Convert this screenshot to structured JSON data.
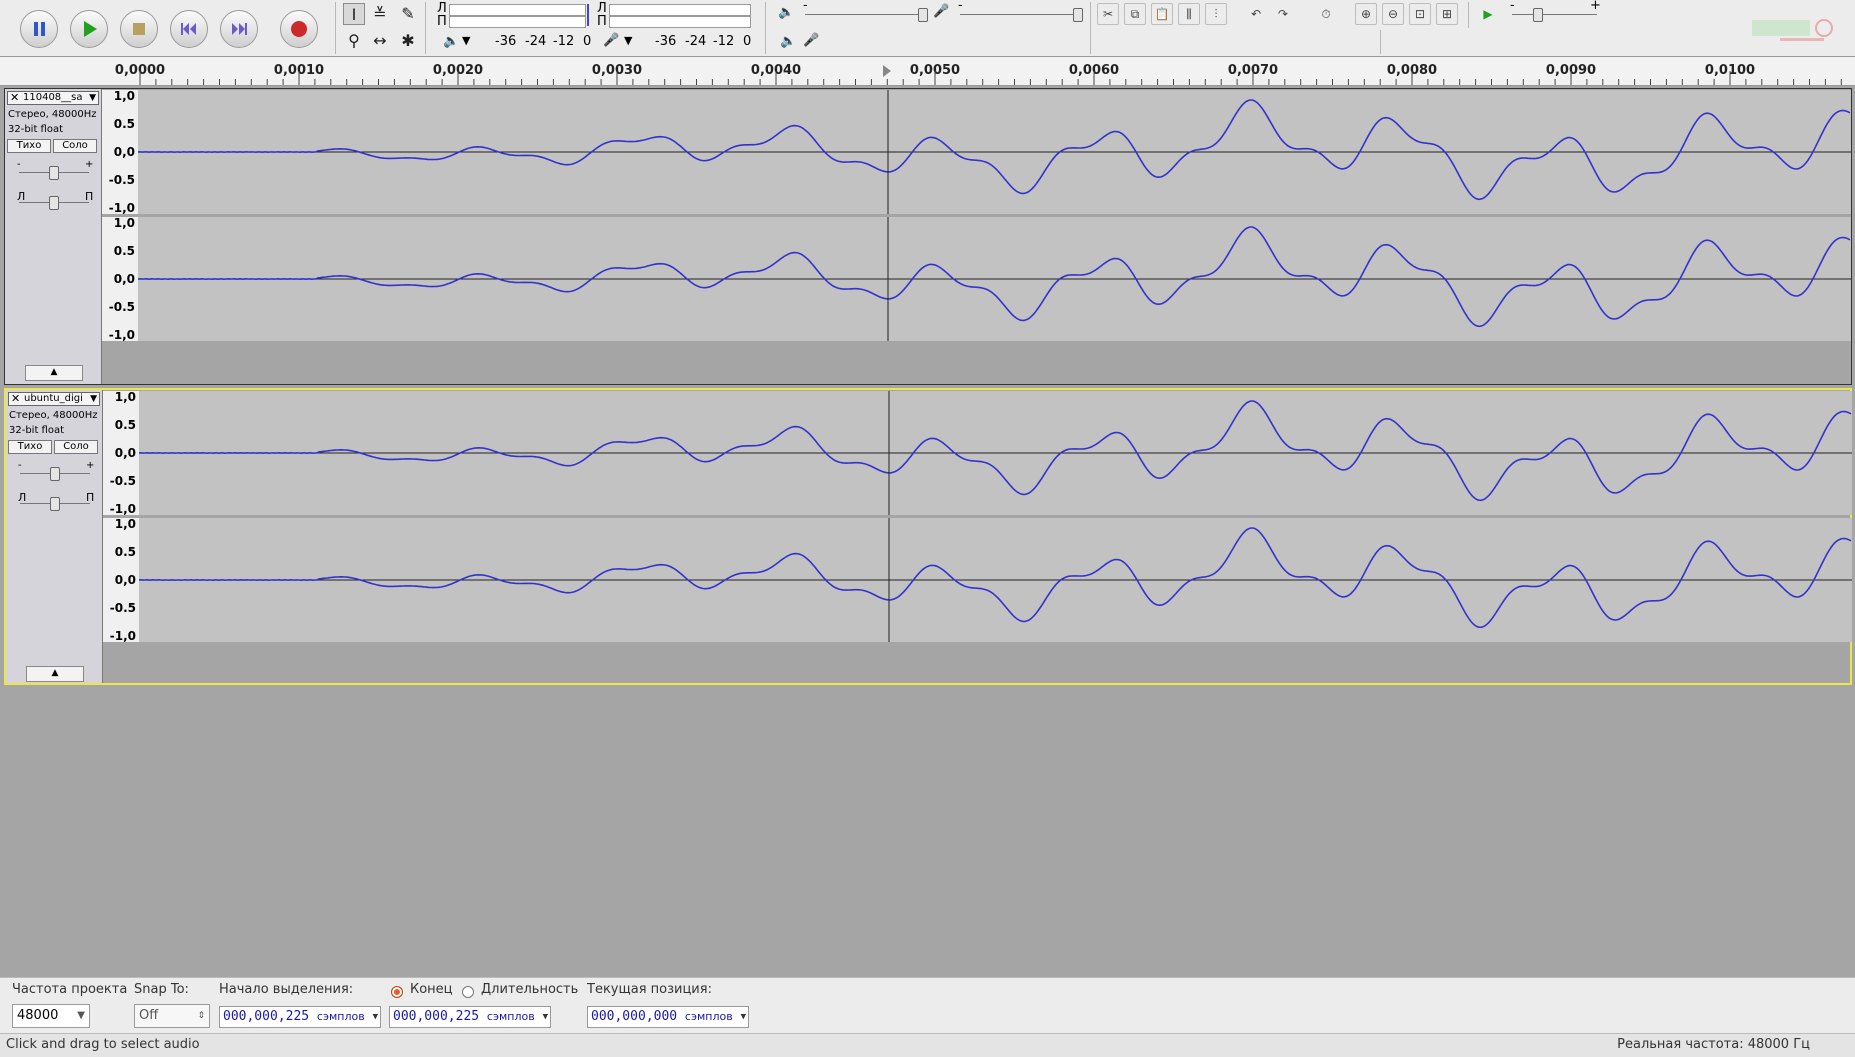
{
  "toolbar": {
    "meter_left_label": "Л",
    "meter_right_label": "П",
    "meter_ticks": [
      "-36",
      "-24",
      "-12",
      "0"
    ],
    "gain_minus": "-",
    "gain_plus": "+"
  },
  "ruler": {
    "labels": [
      "0,0000",
      "0,0010",
      "0,0020",
      "0,0030",
      "0,0040",
      "0,0050",
      "0,0060",
      "0,0070",
      "0,0080",
      "0,0090",
      "0,0100"
    ]
  },
  "tracks": [
    {
      "name": "110408__sa",
      "format": "Стерео, 48000Hz",
      "bitdepth": "32-bit float",
      "mute_label": "Тихо",
      "solo_label": "Соло",
      "pan_left": "Л",
      "pan_right": "П",
      "gain_minus": "-",
      "gain_plus": "+",
      "selected": false
    },
    {
      "name": "ubuntu_digi",
      "format": "Стерео, 48000Hz",
      "bitdepth": "32-bit float",
      "mute_label": "Тихо",
      "solo_label": "Соло",
      "pan_left": "Л",
      "pan_right": "П",
      "gain_minus": "-",
      "gain_plus": "+",
      "selected": true
    }
  ],
  "vscale_labels": [
    "1,0",
    "0.5",
    "0,0",
    "-0.5",
    "-1,0"
  ],
  "selection_bar": {
    "rate_label": "Частота проекта",
    "rate_value": "48000",
    "snap_label": "Snap To:",
    "snap_value": "Off",
    "sel_start_label": "Начало выделения:",
    "sel_start_value": "000,000,225",
    "sel_end_value": "000,000,225",
    "units": "сэмплов",
    "end_radio_label": "Конец",
    "length_radio_label": "Длительность",
    "position_label": "Текущая позиция:",
    "position_value": "000,000,000"
  },
  "status": {
    "left": "Click and drag to select audio",
    "right": "Реальная частота: 48000 Гц"
  },
  "colors": {
    "waveform": "#3333cc",
    "selected_track_border": "#e8e84a",
    "record": "#cc2a2a",
    "play": "#22a022",
    "pause": "#3355cc"
  },
  "icons": [
    "pause-icon",
    "play-icon",
    "stop-icon",
    "skip-start-icon",
    "skip-end-icon",
    "record-icon",
    "selection-tool-icon",
    "envelope-tool-icon",
    "draw-tool-icon",
    "zoom-tool-icon",
    "timeshift-tool-icon",
    "multi-tool-icon",
    "speaker-icon",
    "microphone-icon",
    "undo-icon",
    "redo-icon",
    "sync-lock-icon",
    "zoom-in-icon",
    "zoom-out-icon",
    "fit-selection-icon",
    "fit-project-icon",
    "play-at-speed-icon"
  ]
}
